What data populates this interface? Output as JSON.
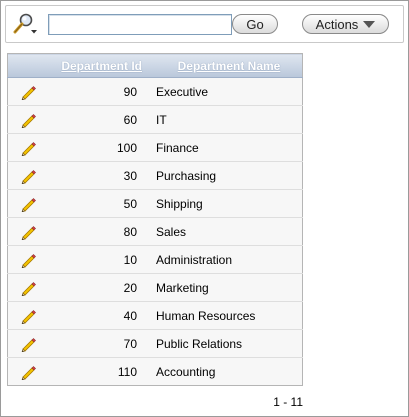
{
  "toolbar": {
    "search_icon": "search-icon",
    "search_value": "",
    "go_label": "Go",
    "actions_label": "Actions"
  },
  "table": {
    "headers": {
      "department_id": "Department Id",
      "department_name": "Department Name"
    },
    "edit_icon": "edit-pencil-icon",
    "rows": [
      {
        "id": "90",
        "name": "Executive"
      },
      {
        "id": "60",
        "name": "IT"
      },
      {
        "id": "100",
        "name": "Finance"
      },
      {
        "id": "30",
        "name": "Purchasing"
      },
      {
        "id": "50",
        "name": "Shipping"
      },
      {
        "id": "80",
        "name": "Sales"
      },
      {
        "id": "10",
        "name": "Administration"
      },
      {
        "id": "20",
        "name": "Marketing"
      },
      {
        "id": "40",
        "name": "Human Resources"
      },
      {
        "id": "70",
        "name": "Public Relations"
      },
      {
        "id": "110",
        "name": "Accounting"
      }
    ]
  },
  "pagination": {
    "range": "1 - 11"
  },
  "colors": {
    "header_top": "#dfe6f0",
    "header_bottom": "#b9c7da",
    "row_bg": "#f7f7f7",
    "pencil": "#f5c400"
  }
}
